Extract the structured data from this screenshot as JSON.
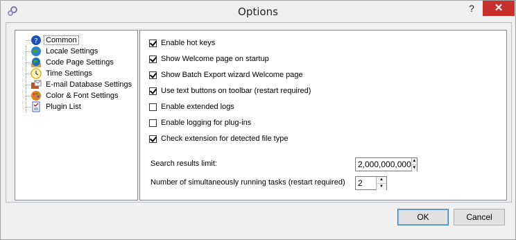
{
  "window": {
    "title": "Options",
    "help": "?",
    "close": "✕"
  },
  "tree": {
    "items": [
      {
        "label": "Common",
        "icon": "help-circle-icon",
        "color": "#1f4fb5"
      },
      {
        "label": "Locale Settings",
        "icon": "globe-icon",
        "color": "#2f7fcf"
      },
      {
        "label": "Code Page Settings",
        "icon": "globe-book-icon",
        "color": "#1f6fb5"
      },
      {
        "label": "Time Settings",
        "icon": "clock-icon",
        "color": "#e0b020"
      },
      {
        "label": "E-mail Database Settings",
        "icon": "mail-database-icon",
        "color": "#c05020"
      },
      {
        "label": "Color & Font Settings",
        "icon": "palette-icon",
        "color": "#e08020"
      },
      {
        "label": "Plugin List",
        "icon": "checklist-icon",
        "color": "#4060c0"
      }
    ]
  },
  "options": [
    {
      "label": "Enable hot keys",
      "checked": true
    },
    {
      "label": "Show Welcome page on startup",
      "checked": true
    },
    {
      "label": "Show Batch Export wizard Welcome page",
      "checked": true
    },
    {
      "label": "Use text buttons on toolbar (restart required)",
      "checked": true
    },
    {
      "label": "Enable extended logs",
      "checked": false
    },
    {
      "label": "Enable logging for plug-ins",
      "checked": false
    },
    {
      "label": "Check extension for detected file type",
      "checked": true
    }
  ],
  "search_limit": {
    "label": "Search results limit:",
    "value": "2,000,000,000"
  },
  "tasks": {
    "label": "Number of simultaneously running tasks (restart required)",
    "value": "2"
  },
  "buttons": {
    "ok": "OK",
    "cancel": "Cancel"
  }
}
